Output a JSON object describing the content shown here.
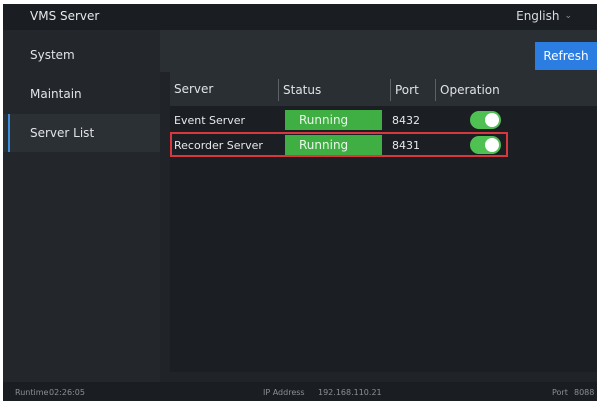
{
  "app": {
    "title": "VMS Server",
    "language": "English"
  },
  "sidebar": {
    "items": [
      {
        "label": "System",
        "active": false
      },
      {
        "label": "Maintain",
        "active": false
      },
      {
        "label": "Server List",
        "active": true
      }
    ]
  },
  "toolbar": {
    "refresh_label": "Refresh"
  },
  "table": {
    "columns": [
      "Server",
      "Status",
      "Port",
      "Operation"
    ],
    "rows": [
      {
        "server": "Event Server",
        "status": "Running",
        "port": "8432",
        "enabled": true
      },
      {
        "server": "Recorder Server",
        "status": "Running",
        "port": "8431",
        "enabled": true
      }
    ]
  },
  "statusbar": {
    "runtime_label": "Runtime",
    "runtime_value": "02:26:05",
    "ip_label": "IP Address",
    "ip_value": "192.168.110.21",
    "port_label": "Port",
    "port_value": "8088"
  },
  "colors": {
    "accent": "#2b7de1",
    "status_running": "#3fae43",
    "toggle_on": "#4fc152",
    "highlight": "#d7383d"
  }
}
